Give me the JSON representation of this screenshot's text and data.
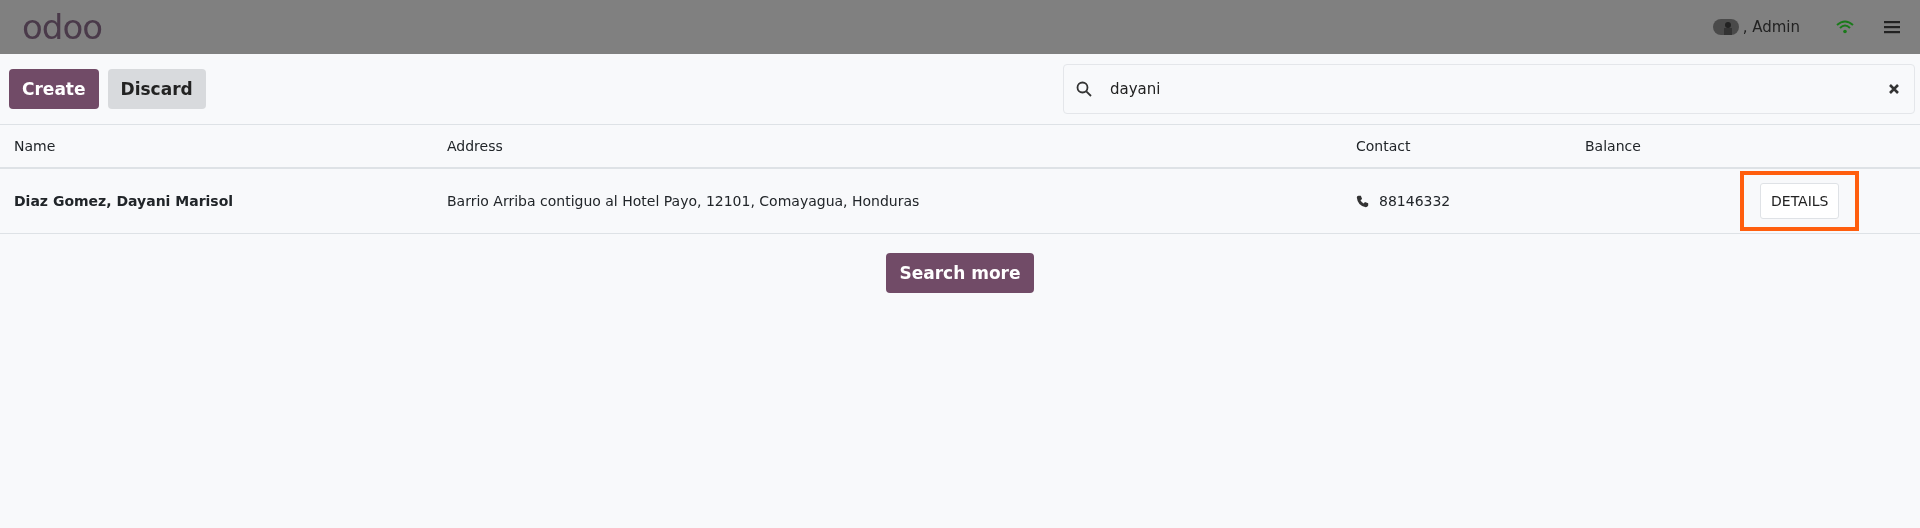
{
  "navbar": {
    "logo": "odoo",
    "user": ", Admin"
  },
  "toolbar": {
    "buttons": [
      {
        "label": "Create",
        "kind": "primary"
      },
      {
        "label": "Discard",
        "kind": "secondary"
      }
    ],
    "search": {
      "value": "dayani"
    }
  },
  "table": {
    "columns": [
      "Name",
      "Address",
      "Contact",
      "Balance"
    ],
    "rows": [
      {
        "name": "Diaz Gomez, Dayani Marisol",
        "address": "Barrio Arriba contiguo al Hotel Payo, 12101, Comayagua, Honduras",
        "contact": "88146332",
        "action": "DETAILS",
        "highlighted": true
      }
    ]
  },
  "search_more": "Search more"
}
